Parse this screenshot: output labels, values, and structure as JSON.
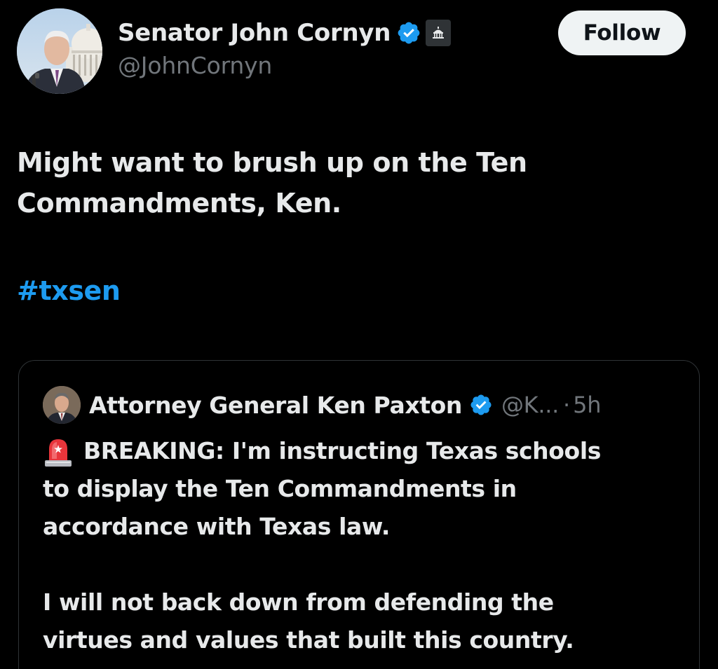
{
  "author": {
    "display_name": "Senator John Cornyn",
    "handle": "@JohnCornyn",
    "verified_icon": "verified-check-icon",
    "government_badge_icon": "capitol-building-icon"
  },
  "follow_button": {
    "label": "Follow"
  },
  "tweet": {
    "text": "Might want to brush up on the Ten\nCommandments, Ken.",
    "hashtag": "#txsen"
  },
  "quoted_tweet": {
    "display_name": "Attorney General Ken Paxton",
    "handle": "@K...",
    "separator": "·",
    "time": "5h",
    "siren_icon": "rotating-light-icon",
    "line1": "BREAKING: I'm instructing Texas schools",
    "line1_rest": "to display the Ten Commandments in\naccordance with Texas law.",
    "paragraph2": "I will not back down from defending the\nvirtues and values that built this country."
  },
  "colors": {
    "background": "#000000",
    "text_primary": "#e7e9ea",
    "text_secondary": "#71767b",
    "link": "#1d9bf0",
    "verified": "#1d9bf0",
    "follow_bg": "#eff3f4",
    "border": "#2f3336"
  }
}
